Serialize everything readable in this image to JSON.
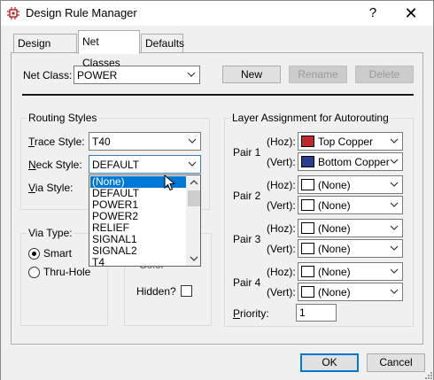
{
  "window": {
    "title": "Design Rule Manager",
    "help": "?",
    "close": "✕"
  },
  "tabs": [
    "Design Rules",
    "Net Classes",
    "Defaults"
  ],
  "net_class": {
    "label": "Net Class:",
    "value": "POWER",
    "new_label": "New",
    "rename_label": "Rename",
    "delete_label": "Delete"
  },
  "routing": {
    "title": "Routing Styles",
    "trace_label": "Trace Style:",
    "trace_value": "T40",
    "neck_label": "Neck Style:",
    "neck_value": "DEFAULT",
    "via_label": "Via Style:"
  },
  "neck_dropdown": {
    "items": [
      "(None)",
      "DEFAULT",
      "POWER1",
      "POWER2",
      "RELIEF",
      "SIGNAL1",
      "SIGNAL2",
      "T4"
    ],
    "highlighted": "(None)"
  },
  "via_type": {
    "title": "Via Type:",
    "smart": "Smart",
    "thru": "Thru-Hole",
    "selected": "Smart"
  },
  "options": {
    "partial_label": "Color",
    "hidden_label": "Hidden?",
    "hidden_checked": false
  },
  "layers": {
    "title": "Layer Assignment for Autorouting",
    "hoz_label": "(Hoz):",
    "vert_label": "(Vert):",
    "pairs": [
      {
        "name": "Pair 1",
        "hoz": "Top Copper",
        "hoz_color": "#c1272d",
        "vert": "Bottom Copper",
        "vert_color": "#2a3d8f"
      },
      {
        "name": "Pair 2",
        "hoz": "(None)",
        "hoz_color": "#ffffff",
        "vert": "(None)",
        "vert_color": "#ffffff"
      },
      {
        "name": "Pair 3",
        "hoz": "(None)",
        "hoz_color": "#ffffff",
        "vert": "(None)",
        "vert_color": "#ffffff"
      },
      {
        "name": "Pair 4",
        "hoz": "(None)",
        "hoz_color": "#ffffff",
        "vert": "(None)",
        "vert_color": "#ffffff"
      }
    ],
    "priority_label": "Priority:",
    "priority_value": "1"
  },
  "footer": {
    "ok": "OK",
    "cancel": "Cancel"
  }
}
